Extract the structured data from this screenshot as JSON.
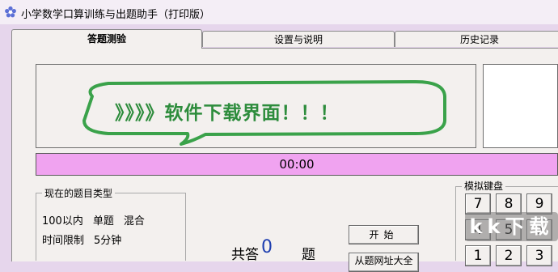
{
  "window": {
    "title": "小学数学口算训练与出题助手（打印版）",
    "icon": "gear-flower-icon"
  },
  "tabs": [
    {
      "label": "答题测验",
      "active": true
    },
    {
      "label": "设置与说明",
      "active": false
    },
    {
      "label": "历史记录",
      "active": false
    }
  ],
  "banner": {
    "text": "》》》》软件下载界面！！！",
    "color": "#2d8c3c"
  },
  "timer": {
    "value": "00:00",
    "color": "#f0a3f0"
  },
  "question_type": {
    "legend": "现在的题目类型",
    "range": "100以内",
    "mode": "单题",
    "mix": "混合",
    "time_limit_label": "时间限制",
    "time_limit_value": "5分钟"
  },
  "total": {
    "prefix": "共答",
    "count": "0",
    "suffix": "题"
  },
  "buttons": {
    "start": "开始",
    "second": "从题网址大全"
  },
  "keyboard": {
    "legend": "模拟键盘",
    "keys": [
      "7",
      "8",
      "9",
      "4",
      "5",
      "6",
      "1",
      "2",
      "3"
    ]
  },
  "watermark": "kk下载"
}
